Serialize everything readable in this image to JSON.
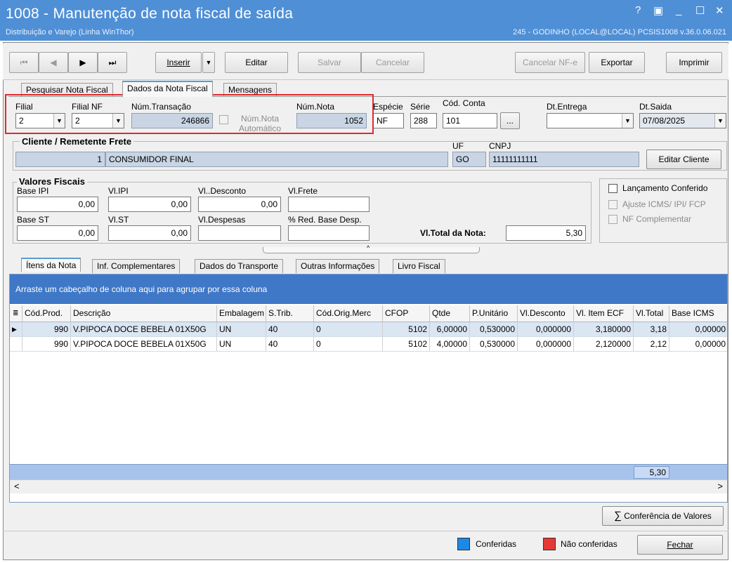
{
  "window": {
    "title": "1008 - Manutenção de nota fiscal de saída",
    "subtitle": "Distribuição e Varejo (Linha WinThor)",
    "userinfo": "245 - GODINHO (LOCAL@LOCAL)   PCSIS1008  v.36.0.06.021",
    "controls": {
      "help": "?",
      "restore": "▣",
      "minimize": "_",
      "maximize": "☐",
      "close": "✕"
    },
    "accent_color": "#4f8fd6"
  },
  "toolbar": {
    "first": "⏮",
    "prev": "◀",
    "next": "▶",
    "last": "⏭",
    "insert": "Inserir",
    "insert_drop": "▼",
    "edit": "Editar",
    "save": "Salvar",
    "cancel": "Cancelar",
    "cancel_nfe": "Cancelar NF-e",
    "export": "Exportar",
    "print": "Imprimir"
  },
  "tabs_top": [
    "Pesquisar Nota Fiscal",
    "Dados da Nota Fiscal",
    "Mensagens"
  ],
  "header": {
    "filial_label": "Filial",
    "filial_value": "2",
    "filialnf_label": "Filial NF",
    "filialnf_value": "2",
    "transacao_label": "Núm.Transação",
    "transacao_value": "246866",
    "auto_label": "Núm.Nota Automático",
    "numnota_label": "Núm.Nota",
    "numnota_value": "1052",
    "especie_label": "Espécie",
    "especie_value": "NF",
    "serie_label": "Série",
    "serie_value": "288",
    "conta_label": "Cód. Conta",
    "conta_value": "101",
    "conta_btn": "...",
    "dtentrega_label": "Dt.Entrega",
    "dtentrega_value": "",
    "dtsaida_label": "Dt.Saida",
    "dtsaida_value": "07/08/2025"
  },
  "cliente": {
    "title": "Cliente / Remetente Frete",
    "code": "1",
    "name": "CONSUMIDOR FINAL",
    "uf_label": "UF",
    "uf_value": "GO",
    "cnpj_label": "CNPJ",
    "cnpj_value": "11111111111",
    "edit_button": "Editar Cliente"
  },
  "valores": {
    "title": "Valores Fiscais",
    "base_ipi_label": "Base IPI",
    "base_ipi": "0,00",
    "vl_ipi_label": "Vl.IPI",
    "vl_ipi": "0,00",
    "vl_desconto_label": "Vl..Desconto",
    "vl_desconto": "0,00",
    "vl_frete_label": "Vl.Frete",
    "vl_frete": "",
    "base_st_label": "Base ST",
    "base_st": "0,00",
    "vl_st_label": "Vl.ST",
    "vl_st": "0,00",
    "vl_despesas_label": "Vl.Despesas",
    "vl_despesas": "",
    "red_base_label": "% Red. Base Desp.",
    "red_base": "",
    "total_label": "Vl.Total da Nota:",
    "total": "5,30"
  },
  "checks": {
    "conferido": "Lançamento Conferido",
    "ajuste": "Ajuste ICMS/ IPI/ FCP",
    "complementar": "NF Complementar"
  },
  "tabs_bottom": [
    "Ítens da Nota",
    "Inf. Complementares",
    "Dados do Transporte",
    "Outras Informações",
    "Livro Fiscal"
  ],
  "grid": {
    "group_hint": "Arraste um cabeçalho de coluna aqui para agrupar por essa coluna",
    "columns": [
      "Cód.Prod.",
      "Descrição",
      "Embalagem",
      "S.Trib.",
      "Cód.Orig.Merc",
      "CFOP",
      "Qtde",
      "P.Unitário",
      "Vl.Desconto",
      "Vl. Item ECF",
      "Vl.Total",
      "Base ICMS"
    ],
    "rows": [
      [
        "990",
        "V.PIPOCA DOCE BEBELA 01X50G",
        "UN",
        "40",
        "0",
        "5102",
        "6,00000",
        "0,530000",
        "0,000000",
        "3,180000",
        "3,18",
        "0,00000"
      ],
      [
        "990",
        "V.PIPOCA DOCE BEBELA 01X50G",
        "UN",
        "40",
        "0",
        "5102",
        "4,00000",
        "0,530000",
        "0,000000",
        "2,120000",
        "2,12",
        "0,00000"
      ]
    ],
    "footer_total": "5,30",
    "scroll_left": "<",
    "scroll_right": ">"
  },
  "bottom": {
    "conferencia": "Conferência de Valores",
    "sigma": "∑",
    "legend_conferidas": "Conferidas",
    "legend_conferidas_color": "#1e88e5",
    "legend_nao": "Não conferidas",
    "legend_nao_color": "#e53935",
    "close": "Fechar"
  },
  "highlight_color": "#e0292f"
}
